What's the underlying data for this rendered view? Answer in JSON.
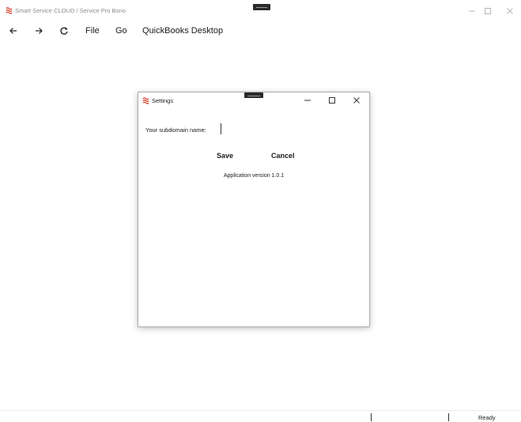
{
  "window": {
    "title": "Smart Service CLOUD / Service Pro Bono"
  },
  "toolbar": {
    "back_icon": "arrow-left-icon",
    "forward_icon": "arrow-right-icon",
    "refresh_icon": "refresh-icon",
    "menu": [
      {
        "label": "File"
      },
      {
        "label": "Go"
      },
      {
        "label": "QuickBooks Desktop"
      }
    ]
  },
  "dialog": {
    "title": "Settings",
    "subdomain_label": "Your subdomain name:",
    "subdomain_value": "",
    "save_label": "Save",
    "cancel_label": "Cancel",
    "version_text": "Application version 1.0.1"
  },
  "statusbar": {
    "status": "Ready"
  },
  "colors": {
    "brand": "#d64b3a",
    "text": "#1a1a1a",
    "title_muted": "#8a8a8a"
  }
}
